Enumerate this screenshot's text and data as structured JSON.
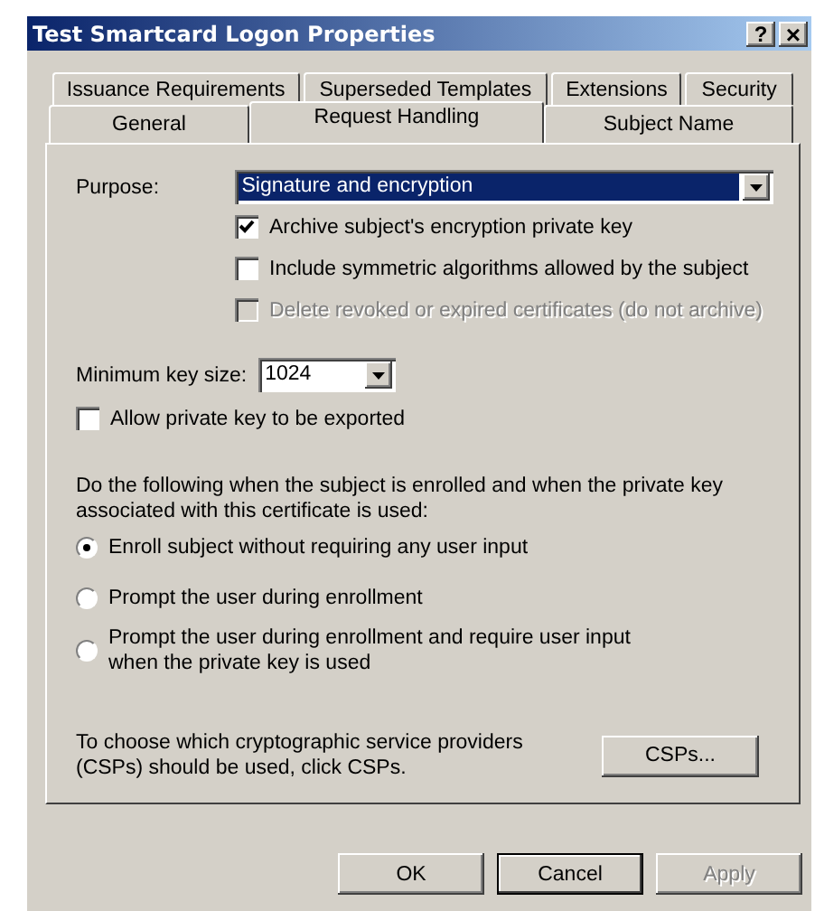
{
  "window": {
    "title": "Test Smartcard Logon Properties",
    "controls": [
      {
        "kind": "help",
        "label": "?"
      },
      {
        "kind": "close",
        "label": "×"
      }
    ]
  },
  "tab_rows": [
    {
      "tabs": [
        {
          "label": "Issuance Requirements",
          "selected": false
        },
        {
          "label": "Superseded Templates",
          "selected": false
        },
        {
          "label": "Extensions",
          "selected": false
        },
        {
          "label": "Security",
          "selected": false
        }
      ]
    },
    {
      "tabs": [
        {
          "label": "General",
          "selected": false
        },
        {
          "label": "Request Handling",
          "selected": true
        },
        {
          "label": "Subject Name",
          "selected": false
        }
      ]
    }
  ],
  "purpose": {
    "label": "Purpose:",
    "value": "Signature and encryption"
  },
  "purpose_options": [
    {
      "label": "Archive subject's encryption private key",
      "checked": true,
      "disabled": false
    },
    {
      "label": "Include symmetric algorithms allowed by the subject",
      "checked": false,
      "disabled": false
    },
    {
      "label": "Delete revoked or expired certificates (do not archive)",
      "checked": false,
      "disabled": true
    }
  ],
  "key_size": {
    "label": "Minimum key size:",
    "value": "1024"
  },
  "export_option": {
    "label": "Allow private key to be exported",
    "checked": false,
    "disabled": false
  },
  "enrollment": {
    "prompt": "Do the following when the subject is enrolled and when the private key associated with this certificate is used:",
    "options": [
      {
        "label": "Enroll subject without requiring any user input",
        "selected": true
      },
      {
        "label": "Prompt the user during enrollment",
        "selected": false
      },
      {
        "label": "Prompt the user during enrollment and require user input when the private key is used",
        "selected": false
      }
    ]
  },
  "csp": {
    "text": "To choose which cryptographic service providers (CSPs) should be used, click CSPs.",
    "button": "CSPs..."
  },
  "buttons": [
    {
      "label": "OK",
      "disabled": false,
      "default": false
    },
    {
      "label": "Cancel",
      "disabled": false,
      "default": true
    },
    {
      "label": "Apply",
      "disabled": true,
      "default": false
    }
  ]
}
